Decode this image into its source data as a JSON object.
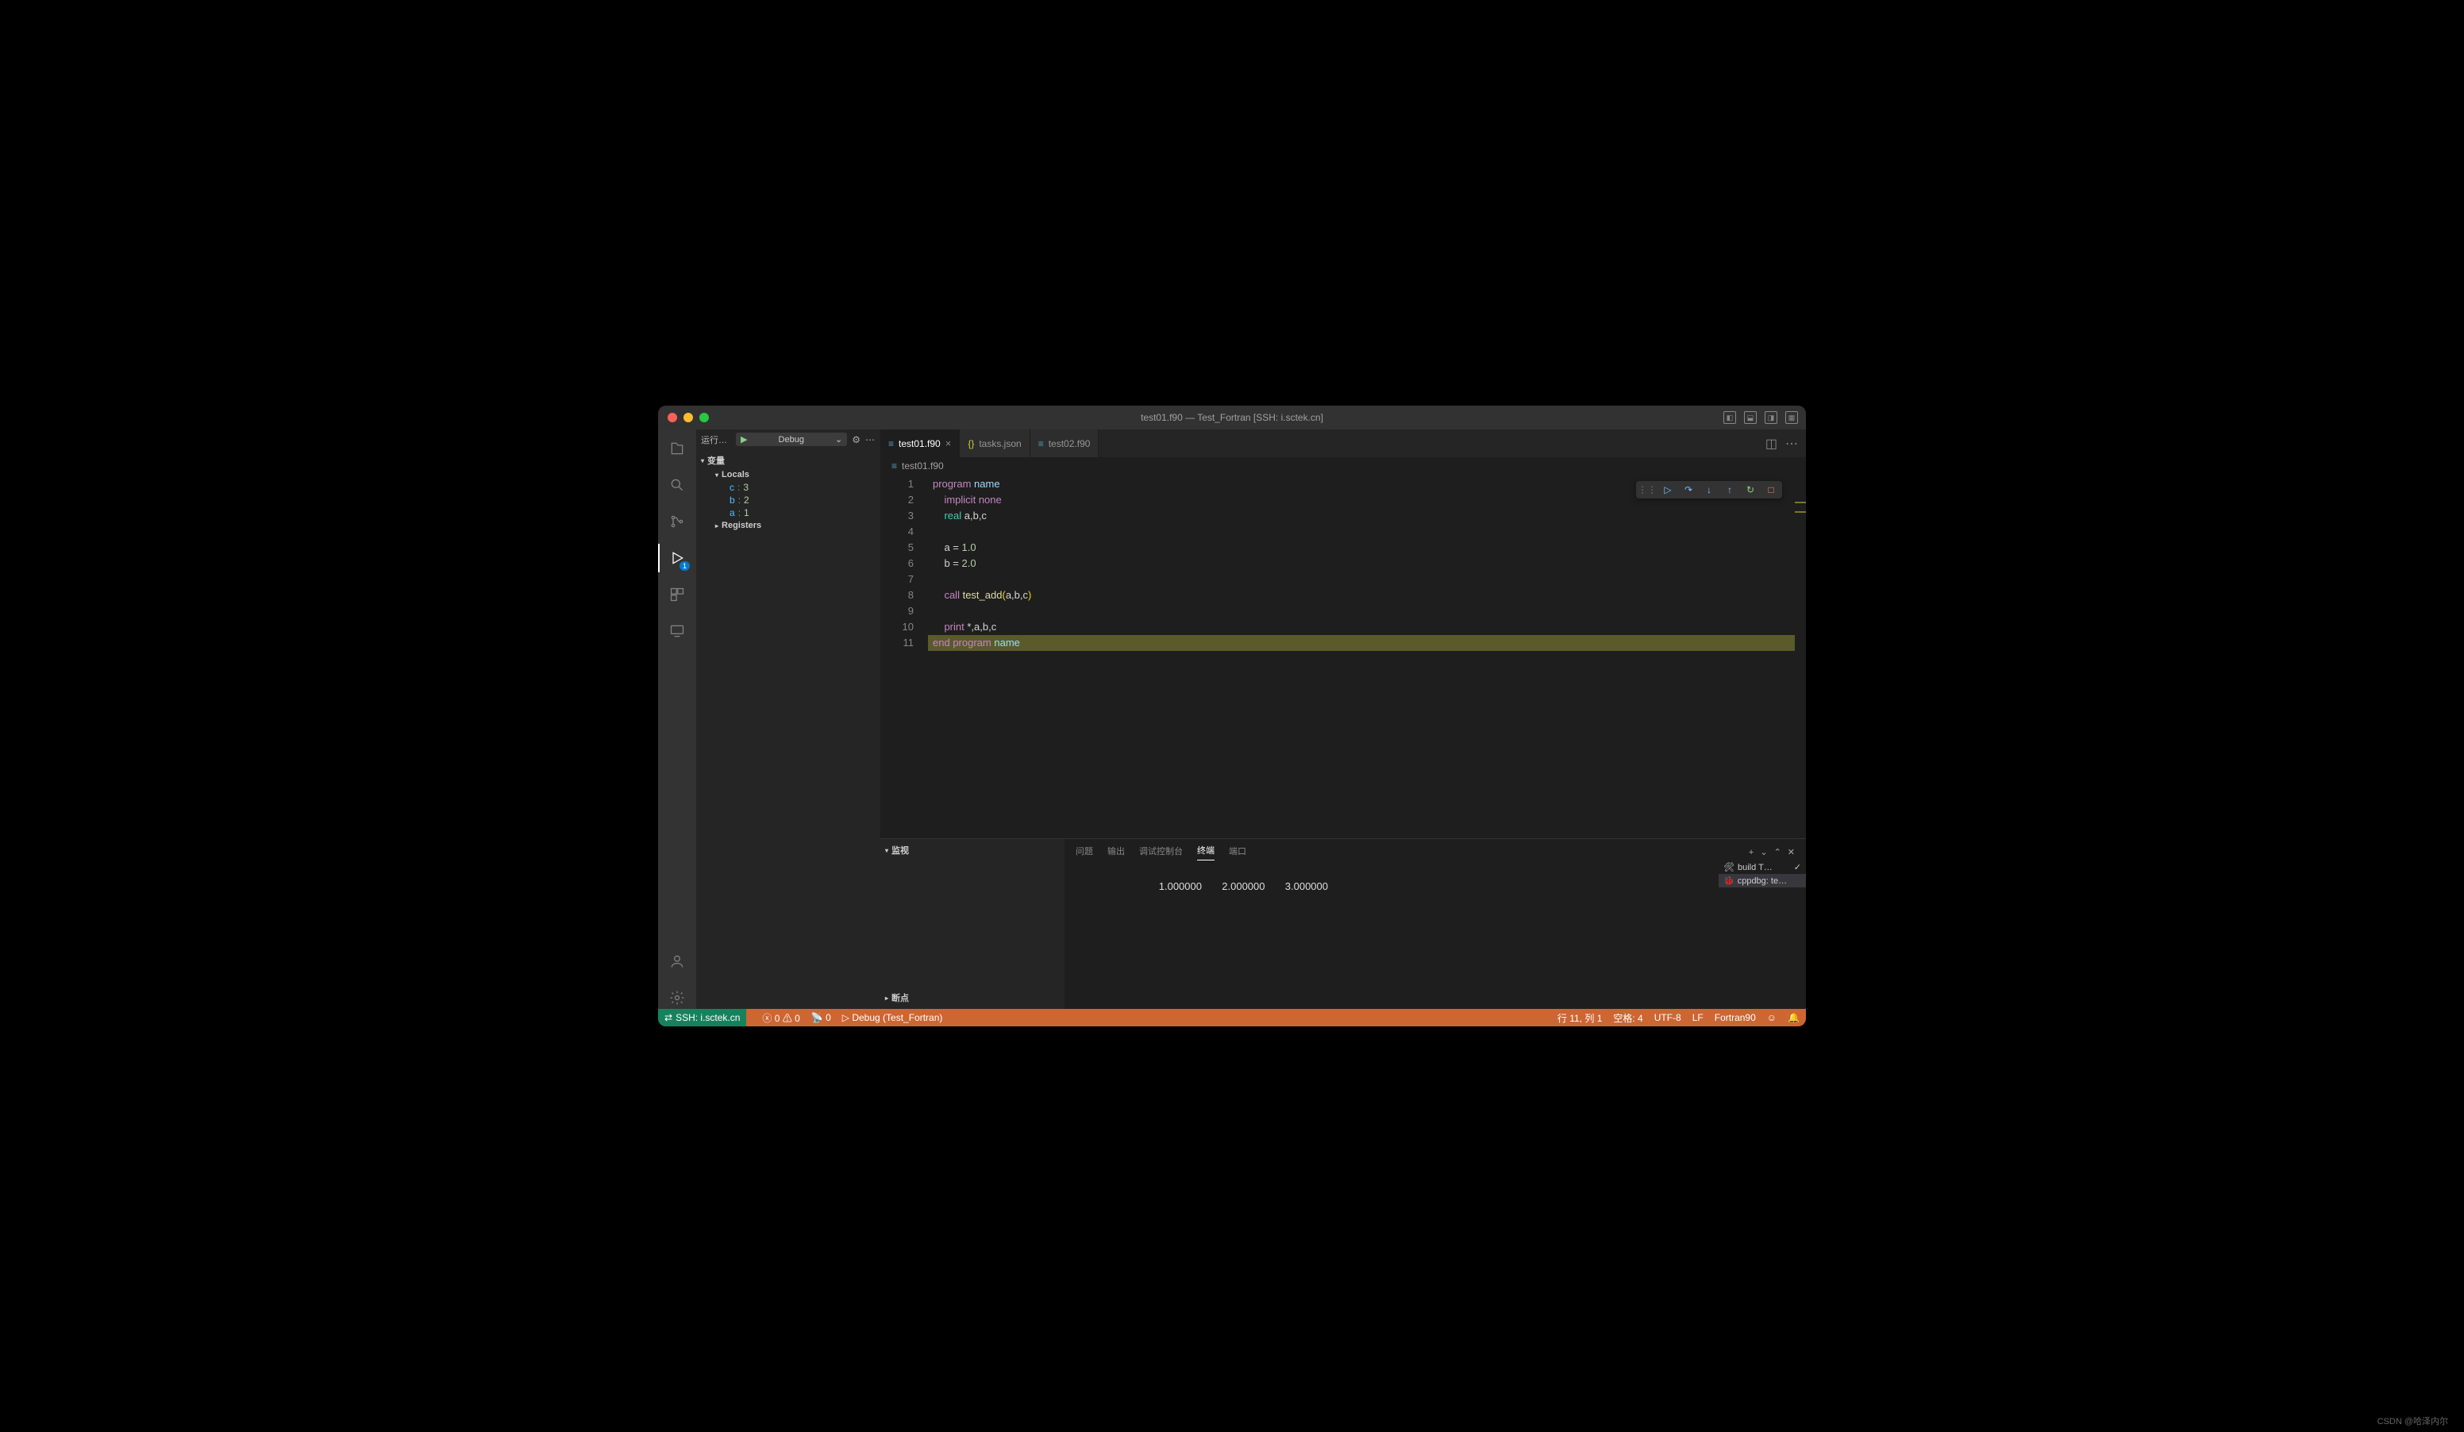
{
  "window": {
    "title": "test01.f90 — Test_Fortran [SSH: i.sctek.cn]"
  },
  "sidebar": {
    "run_label": "运行…",
    "config_name": "Debug",
    "sections": {
      "variables": "变量",
      "locals": "Locals",
      "registers": "Registers",
      "watch": "监视",
      "breakpoints": "断点"
    },
    "locals": [
      {
        "name": "c",
        "value": "3"
      },
      {
        "name": "b",
        "value": "2"
      },
      {
        "name": "a",
        "value": "1"
      }
    ]
  },
  "tabs": [
    {
      "label": "test01.f90",
      "active": true,
      "type": "f90"
    },
    {
      "label": "tasks.json",
      "active": false,
      "type": "json"
    },
    {
      "label": "test02.f90",
      "active": false,
      "type": "f90"
    }
  ],
  "breadcrumb": "test01.f90",
  "code": {
    "lines": [
      {
        "n": 1,
        "html": "<span class='kw'>program</span> <span class='id'>name</span>"
      },
      {
        "n": 2,
        "html": "    <span class='kw'>implicit</span> <span class='kw'>none</span>"
      },
      {
        "n": 3,
        "html": "    <span class='ty'>real</span> a,b,c"
      },
      {
        "n": 4,
        "html": ""
      },
      {
        "n": 5,
        "html": "    a = <span class='num'>1.0</span>"
      },
      {
        "n": 6,
        "html": "    b = <span class='num'>2.0</span>"
      },
      {
        "n": 7,
        "html": ""
      },
      {
        "n": 8,
        "html": "    <span class='kw'>call</span> <span class='fn'>test_add</span><span class='pn'>(</span>a,b,c<span class='pn'>)</span>",
        "bp": true
      },
      {
        "n": 9,
        "html": ""
      },
      {
        "n": 10,
        "html": "    <span class='kw'>print</span> *,a,b,c"
      },
      {
        "n": 11,
        "html": "<span class='kw'>end</span> <span class='kw'>program</span> <span class='id'>name</span>",
        "current": true,
        "hl": true
      }
    ]
  },
  "panel": {
    "tabs": {
      "problems": "问题",
      "output": "输出",
      "debug_console": "调试控制台",
      "terminal": "终端",
      "ports": "端口"
    },
    "terminal_output": "   1.000000       2.000000       3.000000",
    "tasks": [
      {
        "label": "build T…",
        "icon": "tools",
        "done": true
      },
      {
        "label": "cppdbg: te…",
        "icon": "bug",
        "active": true
      }
    ]
  },
  "status": {
    "remote": "SSH: i.sctek.cn",
    "errors": "0",
    "warnings": "0",
    "ports": "0",
    "debug": "Debug (Test_Fortran)",
    "position": "行 11, 列 1",
    "spaces": "空格: 4",
    "encoding": "UTF-8",
    "eol": "LF",
    "language": "Fortran90"
  },
  "watermark": "CSDN @哈泽内尔",
  "activity_badge": "1"
}
